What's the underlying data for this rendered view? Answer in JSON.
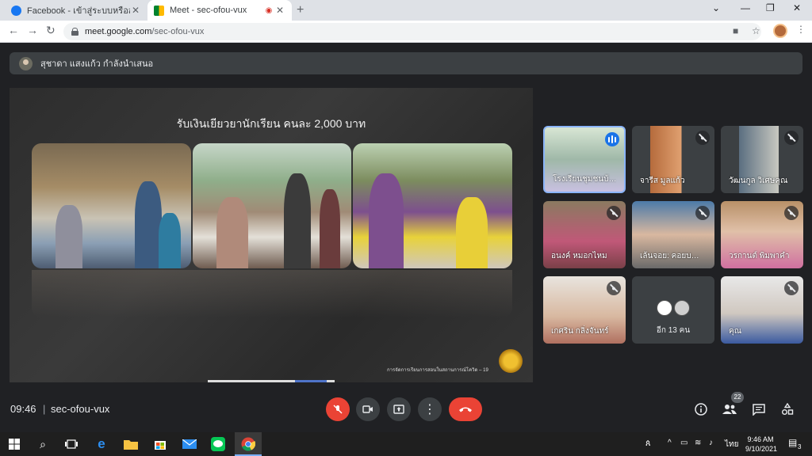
{
  "browser": {
    "tabs": [
      {
        "title": "Facebook - เข้าสู่ระบบหรือสมัครใช้งาน",
        "active": false
      },
      {
        "title": "Meet - sec-ofou-vux",
        "active": true
      }
    ],
    "new_tab": "+",
    "url_host": "meet.google.com",
    "url_path": "/sec-ofou-vux"
  },
  "meet": {
    "presenter_banner": "สุชาดา แสงแก้ว กำลังนำเสนอ",
    "slide": {
      "title": "รับเงินเยียวยานักเรียน คนละ 2,000 บาท",
      "footer": "การจัดการเรียนการสอนในสถานการณ์โควิด – 19"
    },
    "participants": [
      {
        "name": "โรงเรียนชุมชนบ้…",
        "muted": false,
        "speaking": true
      },
      {
        "name": "จารีส มูลแก้ว",
        "muted": true
      },
      {
        "name": "วัฒนกูล วิเศษคุณ",
        "muted": true
      },
      {
        "name": "อนงค์ หมอกไหม",
        "muted": true
      },
      {
        "name": "เล้นจอย: คอยบ…",
        "muted": true
      },
      {
        "name": "วรกานต์ พิมพาคำ",
        "muted": true
      },
      {
        "name": "เกศริน กลิ่งจันทร์",
        "muted": true
      },
      {
        "name": "",
        "more_label": "อีก 13 คน"
      },
      {
        "name": "คุณ",
        "muted": true
      }
    ],
    "bottom": {
      "time": "09:46",
      "separator": "|",
      "meeting_code": "sec-ofou-vux",
      "people_count": "22"
    }
  },
  "taskbar": {
    "language": "ไทย",
    "time": "9:46 AM",
    "date": "9/10/2021",
    "notifications": "3"
  },
  "colors": {
    "meet_bg": "#202124",
    "tile_bg": "#3c4043",
    "hangup_red": "#ea4335",
    "active_border": "#8ab4f8"
  }
}
